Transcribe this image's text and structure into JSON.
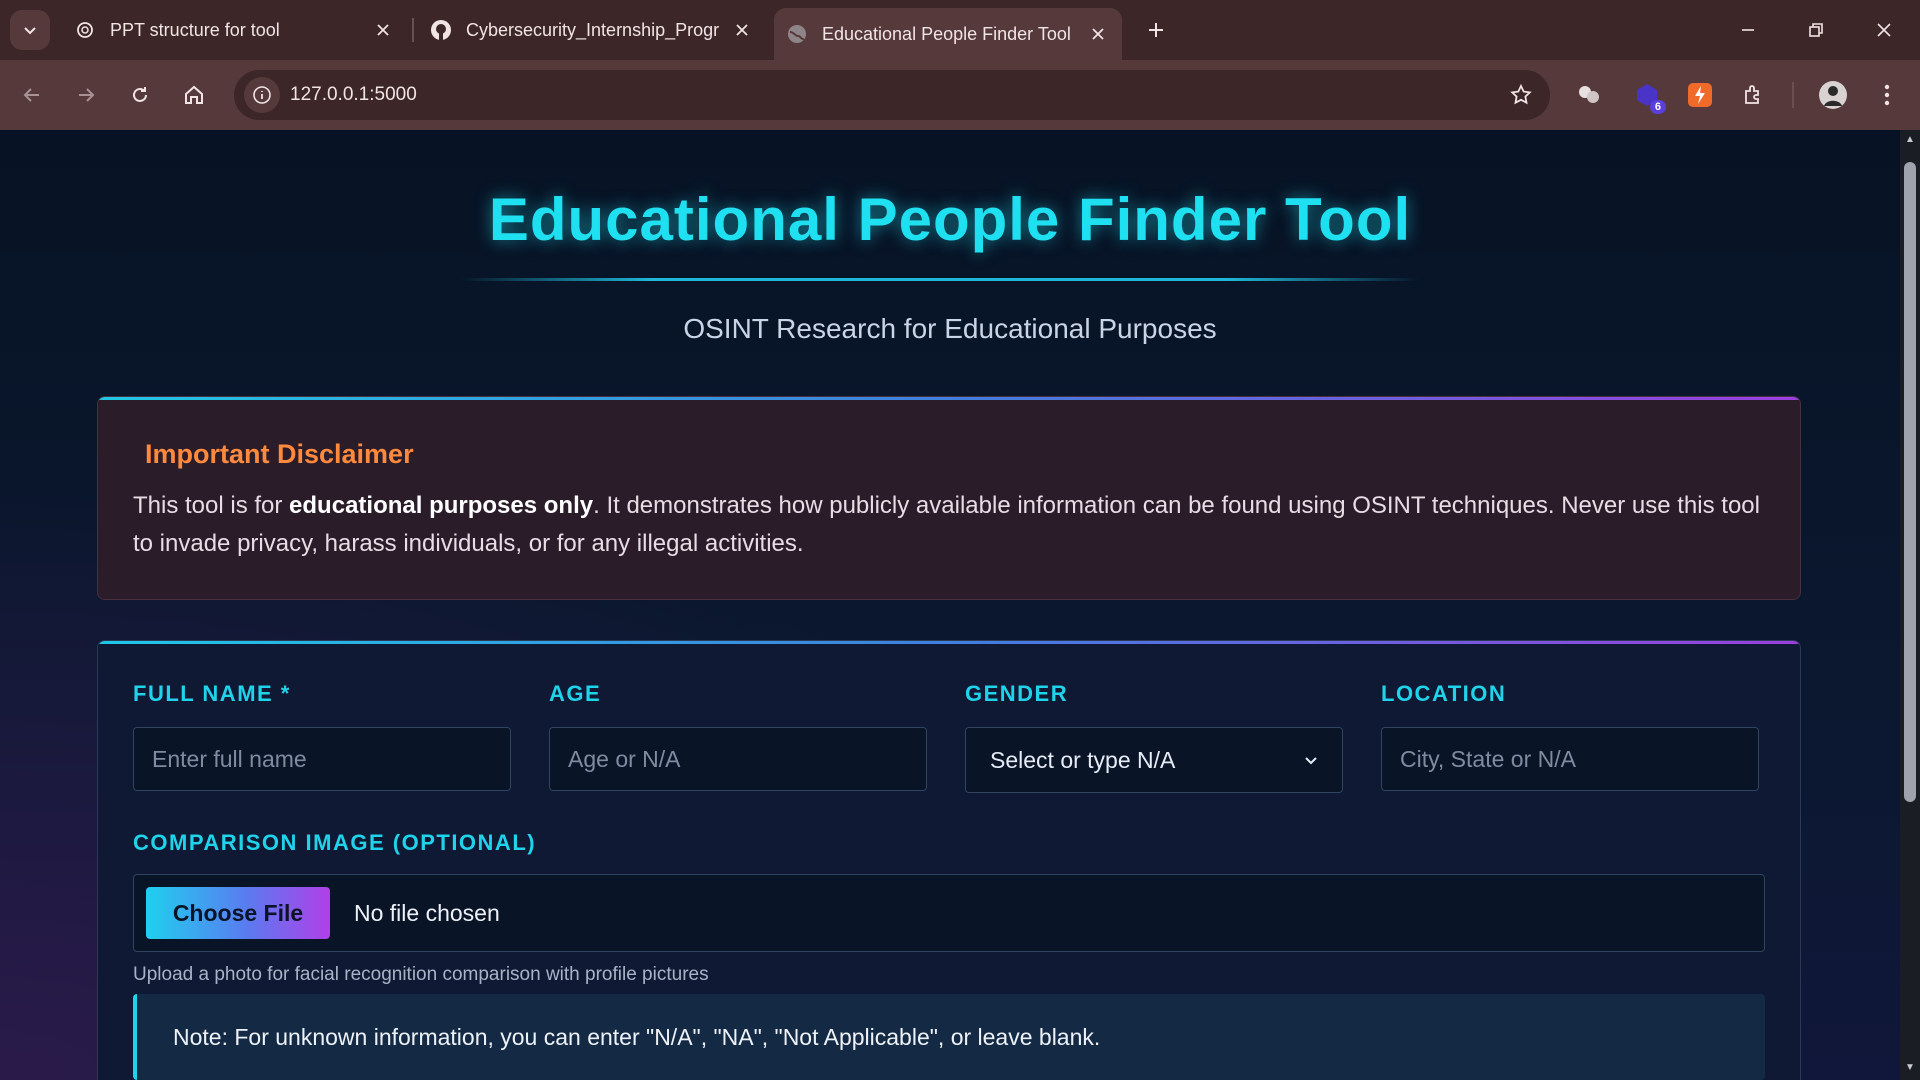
{
  "browser": {
    "tabs": [
      {
        "title": "PPT structure for tool",
        "icon": "openai-icon"
      },
      {
        "title": "Cybersecurity_Internship_Progr",
        "icon": "github-icon"
      },
      {
        "title": "Educational People Finder Tool",
        "icon": "globe-icon",
        "active": true
      }
    ],
    "url": "127.0.0.1:5000",
    "extension_badge": "6"
  },
  "page": {
    "title": "Educational People Finder Tool",
    "subtitle": "OSINT Research for Educational Purposes",
    "disclaimer": {
      "heading": "Important Disclaimer",
      "text_before": "This tool is for ",
      "text_bold": "educational purposes only",
      "text_after": ". It demonstrates how publicly available information can be found using OSINT techniques. Never use this tool to invade privacy, harass individuals, or for any illegal activities."
    },
    "form": {
      "full_name": {
        "label": "FULL NAME *",
        "placeholder": "Enter full name"
      },
      "age": {
        "label": "AGE",
        "placeholder": "Age or N/A"
      },
      "gender": {
        "label": "GENDER",
        "selected": "Select or type N/A"
      },
      "location": {
        "label": "LOCATION",
        "placeholder": "City, State or N/A"
      },
      "comparison": {
        "label": "COMPARISON IMAGE (OPTIONAL)",
        "button": "Choose File",
        "status": "No file chosen",
        "help": "Upload a photo for facial recognition comparison with profile pictures"
      },
      "note": "Note: For unknown information, you can enter \"N/A\", \"NA\", \"Not Applicable\", or leave blank."
    }
  },
  "colors": {
    "accent_cyan": "#1fe0f0",
    "disclaimer_heading": "#ff8a3d",
    "button_gradient": [
      "#1fd0ee",
      "#5a7bf0",
      "#b13fe8"
    ]
  }
}
